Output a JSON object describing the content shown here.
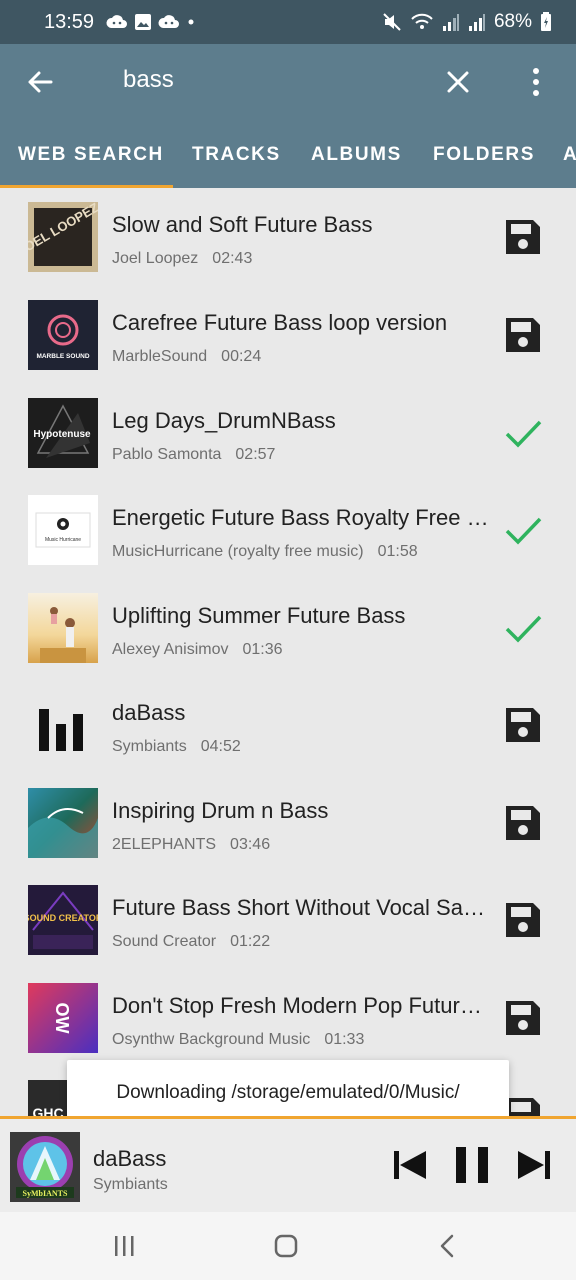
{
  "status_bar": {
    "time": "13:59",
    "battery": "68%",
    "notification_icons": [
      "cloud-icon",
      "image-icon",
      "cloud-icon",
      "dot-icon"
    ]
  },
  "app_bar": {
    "query": "bass",
    "back_icon": "arrow-left-icon",
    "clear_icon": "close-icon",
    "more_icon": "more-vert-icon"
  },
  "tabs": [
    {
      "label": "WEB SEARCH",
      "selected": true
    },
    {
      "label": "TRACKS",
      "selected": false
    },
    {
      "label": "ALBUMS",
      "selected": false
    },
    {
      "label": "FOLDERS",
      "selected": false
    },
    {
      "label": "A",
      "selected": false
    }
  ],
  "colors": {
    "status_bar": "#3f5662",
    "app_bar": "#5d7d8d",
    "accent": "#f0a530",
    "check": "#2fb35e",
    "background": "#e9e9e9"
  },
  "tracks": [
    {
      "title": "Slow and Soft Future Bass",
      "artist": "Joel Loopez",
      "duration": "02:43",
      "action": "save-icon",
      "thumb_text": "JOEL LOOPEZ"
    },
    {
      "title": "Carefree Future Bass  loop version",
      "artist": "MarbleSound",
      "duration": "00:24",
      "action": "save-icon",
      "thumb_text": "MARBLE SOUND"
    },
    {
      "title": "Leg Days_DrumNBass",
      "artist": "Pablo Samonta",
      "duration": "02:57",
      "action": "check-icon",
      "thumb_text": "Hypotenuse"
    },
    {
      "title": "Energetic Future Bass  Royalty Free Music",
      "artist": "MusicHurricane (royalty free music)",
      "duration": "01:58",
      "action": "check-icon",
      "thumb_text": "Music Hurricane"
    },
    {
      "title": "Uplifting Summer Future Bass",
      "artist": "Alexey Anisimov",
      "duration": "01:36",
      "action": "check-icon",
      "thumb_text": ""
    },
    {
      "title": "daBass",
      "artist": "Symbiants",
      "duration": "04:52",
      "action": "save-icon",
      "thumb_text": ""
    },
    {
      "title": "Inspiring Drum n Bass",
      "artist": "2ELEPHANTS",
      "duration": "03:46",
      "action": "save-icon",
      "thumb_text": ""
    },
    {
      "title": "Future Bass  Short Without Vocal Sample",
      "artist": "Sound Creator",
      "duration": "01:22",
      "action": "save-icon",
      "thumb_text": "SOUND CREATOR"
    },
    {
      "title": "Don't Stop  Fresh Modern Pop Future Bass",
      "artist": "Osynthw Background Music",
      "duration": "01:33",
      "action": "save-icon",
      "thumb_text": "OW"
    },
    {
      "title": "",
      "artist": "",
      "duration": "",
      "action": "save-icon",
      "thumb_text": "GHC"
    }
  ],
  "toast": {
    "text": "Downloading /storage/emulated/0/Music/"
  },
  "player": {
    "title": "daBass",
    "artist": "Symbiants",
    "art_text": "SyMbIANTS",
    "prev_icon": "skip-previous-icon",
    "pause_icon": "pause-icon",
    "next_icon": "skip-next-icon"
  },
  "nav_bar": {
    "recents_icon": "recents-icon",
    "home_icon": "home-icon",
    "back_icon": "nav-back-icon"
  }
}
